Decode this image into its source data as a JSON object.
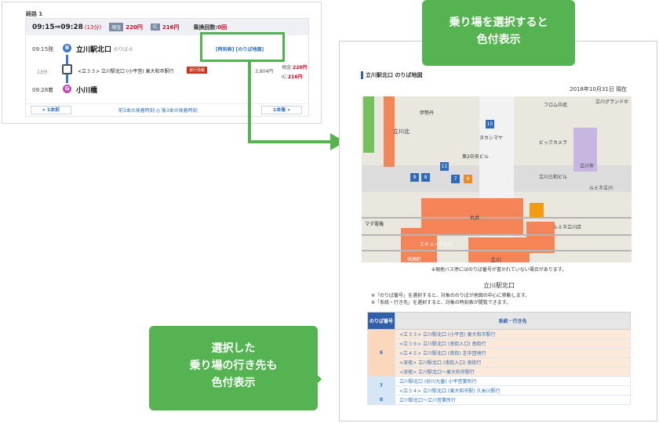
{
  "route": {
    "number": "経路 1",
    "time": "09:15⇒09:28",
    "duration": "(13分)",
    "cash_label": "現金",
    "cash_fare": "220円",
    "ic_label": "IC",
    "ic_fare": "216円",
    "transfer_label": "乗換回数:",
    "transfer_count": "0回",
    "departure": {
      "time": "09:15発",
      "badge": "B",
      "name": "立川駅北口",
      "platform": "のりば:6"
    },
    "links": "[時刻表] [のりば地図]",
    "segment": {
      "minutes": "13分",
      "line": "<立３３> 立川駅北口 (小平営) 東大和市駅行",
      "badge": "運行情報",
      "fare": "3,804円",
      "cash": "現金:",
      "cash_val": "220円",
      "ic": "IC:",
      "ic_val": "216円"
    },
    "arrival": {
      "time": "09:28着",
      "badge": "G",
      "name": "小川橋"
    },
    "pager": {
      "prev": "«   1本前",
      "mid": "前3本の発着時刻  ◎  後3本の発着時刻",
      "next": "1本後   »"
    }
  },
  "callouts": {
    "top": [
      "乗り場を選択すると",
      "色付表示"
    ],
    "bottom": [
      "選択した",
      "乗り場の行き先も",
      "色付表示"
    ]
  },
  "doc": {
    "title": "立川駅北口 のりば地図",
    "date": "2018年10月31日 現在",
    "map_labels": {
      "north": "立川北",
      "isetan": "伊勢丹",
      "from_naka": "フロム中武",
      "grand": "立川グランドホ",
      "takashimaya": "タカシマヤ",
      "bic": "ビックカメラ",
      "daini": "第2中央ビル",
      "sanpo": "立川三和ビル",
      "city": "立川市",
      "lumine": "ルミネ立川",
      "marui": "丸井",
      "tachikawa": "立川",
      "asahi": "マダ電機",
      "kita": "栄高町",
      "ekiute": "エキュート立川",
      "lumine2": "ルミネ立川店"
    },
    "pins": [
      "15",
      "11",
      "9",
      "8",
      "7",
      "6"
    ],
    "map_note": "※現地バス停にはのりば番号が書かれていない場合があります。",
    "station": "立川駅北口",
    "note1": "※「のりば番号」を選択すると、対象ののりばが地図の中心に移動します。",
    "note2": "※「系統・行き先」を選択すると、対象の時刻表が閲覧できます。",
    "table": {
      "col_no": "のりば番号",
      "col_dest": "系統・行き先",
      "rows": [
        {
          "no": "6",
          "dest": "<立３３> 立川駅北口 (小平営) 東大和市駅行",
          "hl": true
        },
        {
          "no": "",
          "dest": "<立３９> 立川駅北口 (南街入口) 南街行",
          "hl": true
        },
        {
          "no": "",
          "dest": "<立４５> 立川駅北口 (南街) 芝中団地行",
          "hl": true
        },
        {
          "no": "",
          "dest": "<深夜> 立川駅北口 (南街入口) 南街行",
          "hl": true
        },
        {
          "no": "",
          "dest": "<深夜> 立川駅北口～東大和市駅行",
          "hl": true
        },
        {
          "no": "7",
          "dest": "立川駅北口 (砂川九番) 小平営業所行",
          "hl": false
        },
        {
          "no": "",
          "dest": "<立３４> 立川駅北口 (東大和市駅) 久米川駅行",
          "hl": false
        },
        {
          "no": "8",
          "dest": "立川駅北口～立川営業所行",
          "hl": false
        }
      ]
    }
  },
  "colors": {
    "accent_green": "#55b451",
    "highlight_orange": "#f58559",
    "link_blue": "#2a6ebb",
    "fare_red": "#d0021b"
  }
}
